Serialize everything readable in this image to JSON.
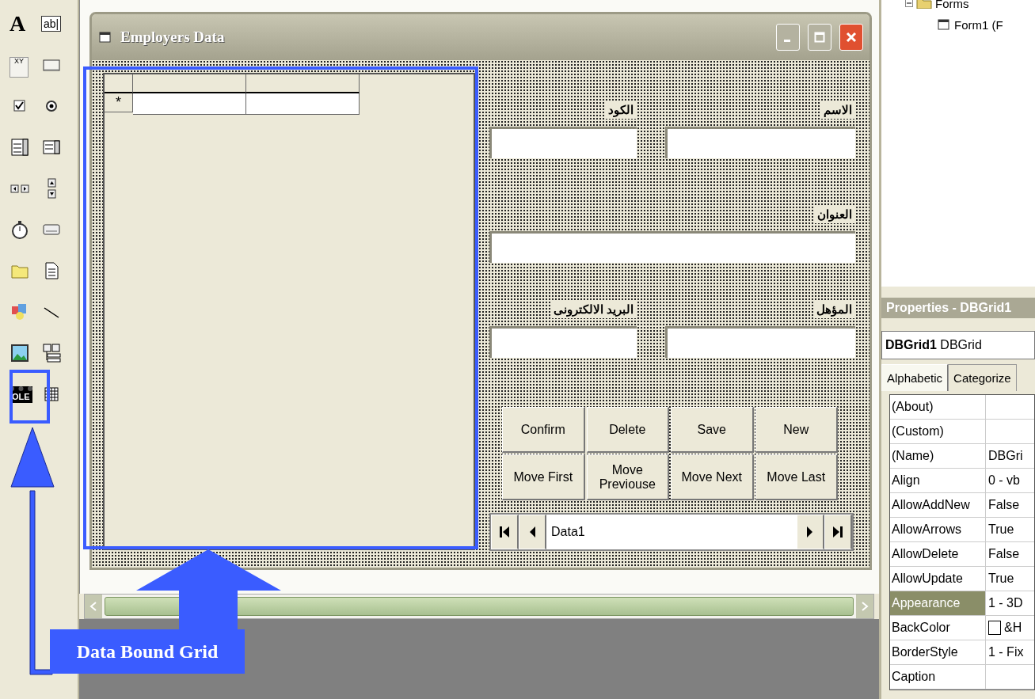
{
  "toolbox": [
    {
      "kind": "label",
      "text": "A"
    },
    {
      "kind": "textbox",
      "text": "ab|"
    },
    {
      "kind": "frame",
      "text": "XY"
    },
    {
      "kind": "command"
    },
    {
      "kind": "checkbox"
    },
    {
      "kind": "option"
    },
    {
      "kind": "combo"
    },
    {
      "kind": "list"
    },
    {
      "kind": "hscroll"
    },
    {
      "kind": "vscroll"
    },
    {
      "kind": "timer"
    },
    {
      "kind": "drive"
    },
    {
      "kind": "dir"
    },
    {
      "kind": "file"
    },
    {
      "kind": "shape"
    },
    {
      "kind": "line"
    },
    {
      "kind": "image"
    },
    {
      "kind": "data"
    },
    {
      "kind": "ole",
      "text": "OLE"
    },
    {
      "kind": "grid"
    }
  ],
  "form": {
    "title": "Employers Data",
    "grid": {
      "rows": [
        {
          "marker": "*"
        }
      ]
    },
    "field_rows": [
      [
        {
          "label": "الاسم"
        },
        {
          "label": "الكود"
        }
      ],
      [
        {
          "label": "العنوان"
        }
      ],
      [
        {
          "label": "المؤهل"
        },
        {
          "label": "البريد الالكترونى"
        }
      ]
    ],
    "buttons": [
      [
        "Confirm",
        "Delete",
        "Save",
        "New"
      ],
      [
        "Move First",
        "Move Previouse",
        "Move Next",
        "Move Last"
      ]
    ],
    "data_control": {
      "caption": "Data1"
    }
  },
  "project": {
    "folder": "Forms",
    "children": [
      {
        "label": "Form1 (F"
      }
    ]
  },
  "properties": {
    "title": "Properties - DBGrid1",
    "object": "**DBGrid1** DBGrid",
    "tabs": [
      {
        "label": "Alphabetic",
        "selected": true
      },
      {
        "label": "Categorize",
        "selected": false
      }
    ],
    "rows": [
      {
        "name": "(About)",
        "kind": "text",
        "selected": false
      },
      {
        "name": "(Custom)",
        "kind": "text",
        "selected": false
      },
      {
        "name": "(Name)",
        "value": "DBGri",
        "kind": "text",
        "selected": false
      },
      {
        "name": "Align",
        "value": "0 - vb",
        "kind": "text",
        "selected": false
      },
      {
        "name": "AllowAddNew",
        "value": "False",
        "kind": "text",
        "selected": false
      },
      {
        "name": "AllowArrows",
        "value": "True",
        "kind": "text",
        "selected": false
      },
      {
        "name": "AllowDelete",
        "value": "False",
        "kind": "text",
        "selected": false
      },
      {
        "name": "AllowUpdate",
        "value": "True",
        "kind": "text",
        "selected": false
      },
      {
        "name": "Appearance",
        "value": "1 - 3D",
        "kind": "text",
        "selected": true
      },
      {
        "name": "BackColor",
        "value": "&H",
        "kind": "color",
        "selected": false
      },
      {
        "name": "BorderStyle",
        "value": "1 - Fix",
        "kind": "text",
        "selected": false
      },
      {
        "name": "Caption",
        "kind": "text",
        "selected": false
      }
    ]
  },
  "annotation": {
    "label": "Data Bound Grid"
  }
}
